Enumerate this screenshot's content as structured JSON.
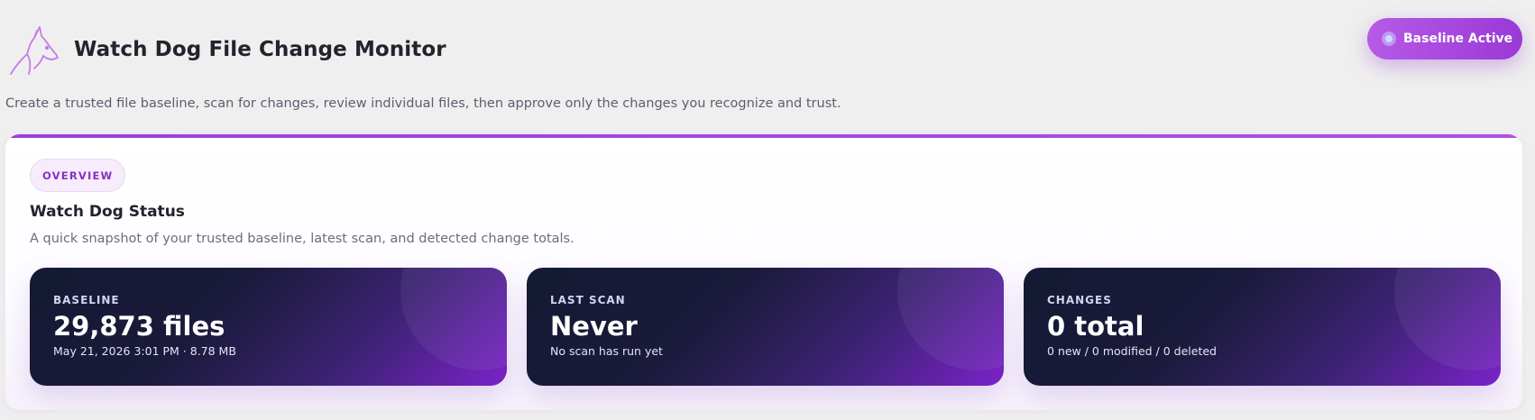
{
  "header": {
    "title": "Watch Dog File Change Monitor",
    "logo_icon": "dog-head-icon",
    "status_pill": "Baseline Active",
    "status_icon": "status-dot-icon"
  },
  "intro": "Create a trusted file baseline, scan for changes, review individual files, then approve only the changes you recognize and trust.",
  "overview": {
    "tag": "OVERVIEW",
    "title": "Watch Dog Status",
    "subtitle": "A quick snapshot of your trusted baseline, latest scan, and detected change totals.",
    "cards": [
      {
        "label": "BASELINE",
        "value": "29,873 files",
        "detail": "May 21, 2026 3:01 PM · 8.78 MB"
      },
      {
        "label": "LAST SCAN",
        "value": "Never",
        "detail": "No scan has run yet"
      },
      {
        "label": "CHANGES",
        "value": "0 total",
        "detail": "0 new / 0 modified / 0 deleted"
      }
    ]
  },
  "colors": {
    "accent": "#9b3fe0",
    "pill": "#b65ae6",
    "card_dark": "#141a33",
    "card_purple": "#7b22c9"
  }
}
